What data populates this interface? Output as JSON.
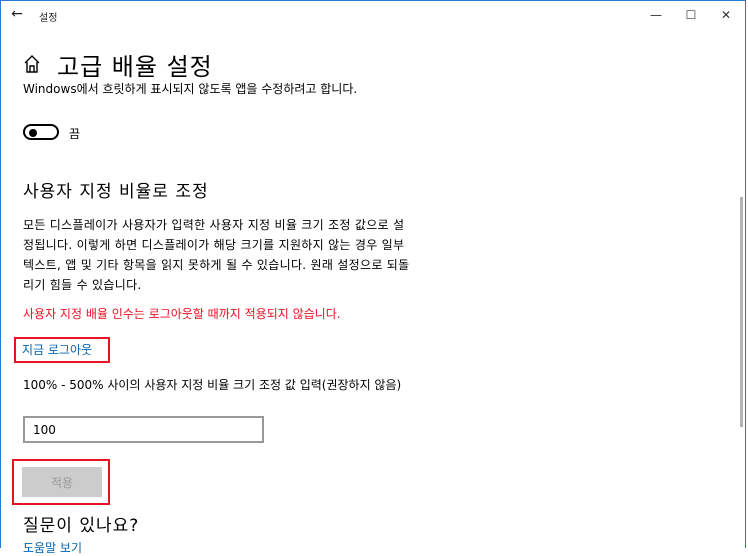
{
  "titlebar": {
    "back_glyph": "←",
    "title": "설정",
    "minimize_glyph": "—",
    "maximize_glyph": "☐",
    "close_glyph": "✕"
  },
  "page": {
    "title": "고급 배율 설정",
    "fix_apps_description": "Windows에서 흐릿하게 표시되지 않도록 앱을 수정하려고 합니다.",
    "toggle_label": "끔",
    "toggle_state": "off"
  },
  "custom_scaling": {
    "heading": "사용자 지정 비율로 조정",
    "description": "모든 디스플레이가 사용자가 입력한 사용자 지정 비율 크기 조정 값으로 설정됩니다. 이렇게 하면 디스플레이가 해당 크기를 지원하지 않는 경우 일부 텍스트, 앱 및 기타 항목을 읽지 못하게 될 수 있습니다. 원래 설정으로 되돌리기 힘들 수 있습니다.",
    "warning": "사용자 지정 배율 인수는 로그아웃할 때까지 적용되지 않습니다.",
    "signout_link": "지금 로그아웃",
    "range_label": "100% - 500% 사이의 사용자 지정 비율 크기 조정 값 입력(권장하지 않음)",
    "input_value": "100",
    "apply_button": "적용"
  },
  "help": {
    "heading": "질문이 있나요?",
    "link": "도움말 보기"
  },
  "colors": {
    "accent": "#0063b1",
    "warning": "#e81123",
    "window_border": "#2b79d6"
  }
}
